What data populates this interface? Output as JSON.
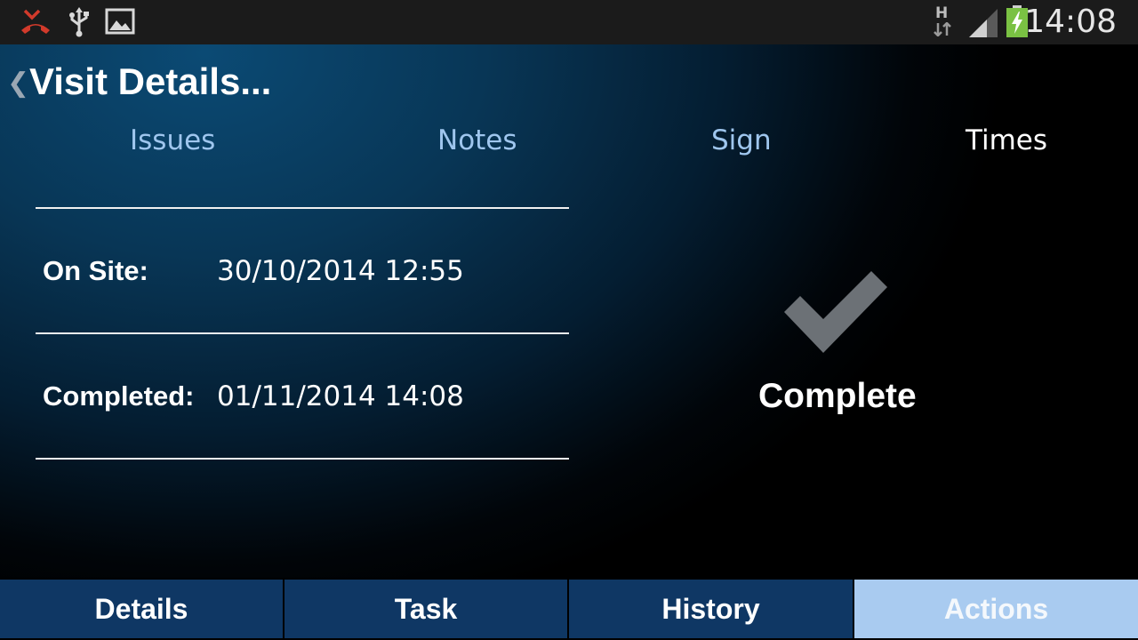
{
  "status_bar": {
    "time": "14:08",
    "network_label": "H",
    "icons": [
      "missed-call-icon",
      "usb-icon",
      "image-icon",
      "data-activity-icon",
      "signal-icon",
      "battery-charging-icon"
    ]
  },
  "header": {
    "title": "Visit Details...",
    "back_icon": "chevron-left-icon"
  },
  "tabs": [
    {
      "label": "Issues",
      "active": false
    },
    {
      "label": "Notes",
      "active": false
    },
    {
      "label": "Sign",
      "active": false
    },
    {
      "label": "Times",
      "active": true
    }
  ],
  "times": [
    {
      "label": "On Site:",
      "value": "30/10/2014 12:55"
    },
    {
      "label": "Completed:",
      "value": "01/11/2014 14:08"
    }
  ],
  "status": {
    "icon": "checkmark-icon",
    "text": "Complete"
  },
  "bottom_nav": [
    {
      "label": "Details",
      "active": false
    },
    {
      "label": "Task",
      "active": false
    },
    {
      "label": "History",
      "active": false
    },
    {
      "label": "Actions",
      "active": true
    }
  ],
  "colors": {
    "tab_inactive": "#9fc6ee",
    "nav_button": "#0f3764",
    "nav_button_active": "#a9cbf0",
    "missed_call_red": "#d23a2b",
    "battery_green": "#7ac143"
  }
}
